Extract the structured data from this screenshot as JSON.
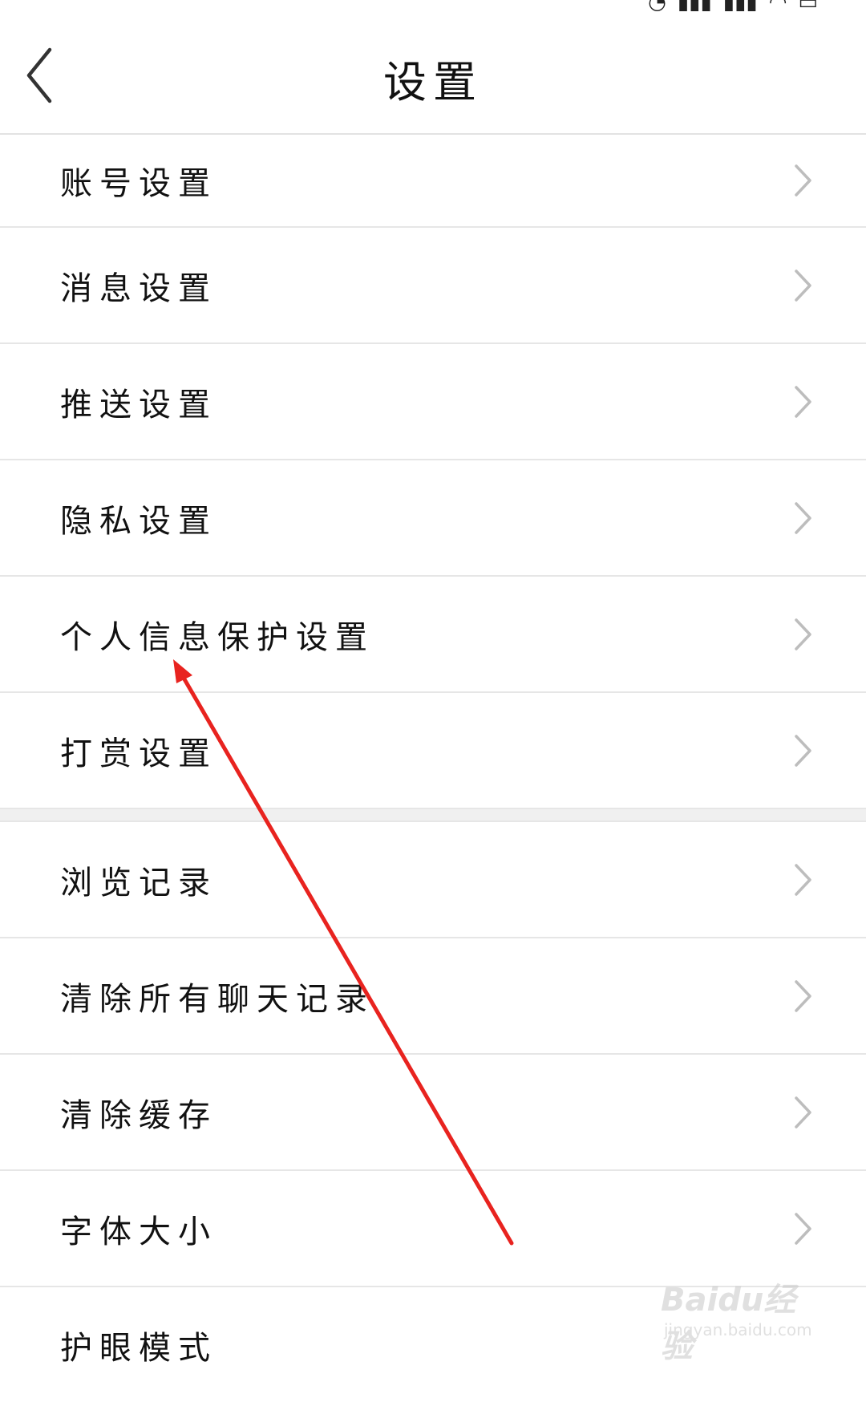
{
  "header": {
    "title": "设置"
  },
  "settings": {
    "group1": [
      {
        "label": "账号设置"
      },
      {
        "label": "消息设置"
      },
      {
        "label": "推送设置"
      },
      {
        "label": "隐私设置"
      },
      {
        "label": "个人信息保护设置"
      },
      {
        "label": "打赏设置"
      }
    ],
    "group2": [
      {
        "label": "浏览记录"
      },
      {
        "label": "清除所有聊天记录"
      },
      {
        "label": "清除缓存"
      },
      {
        "label": "字体大小"
      },
      {
        "label": "护眼模式"
      }
    ]
  },
  "watermark": {
    "brand": "Baidu经验",
    "url": "jingyan.baidu.com"
  },
  "colors": {
    "arrow": "#e8231f",
    "divider": "#e6e6e6",
    "chevron": "#bdbdbd"
  },
  "icons": {
    "back": "chevron-left-icon",
    "row": "chevron-right-icon"
  }
}
